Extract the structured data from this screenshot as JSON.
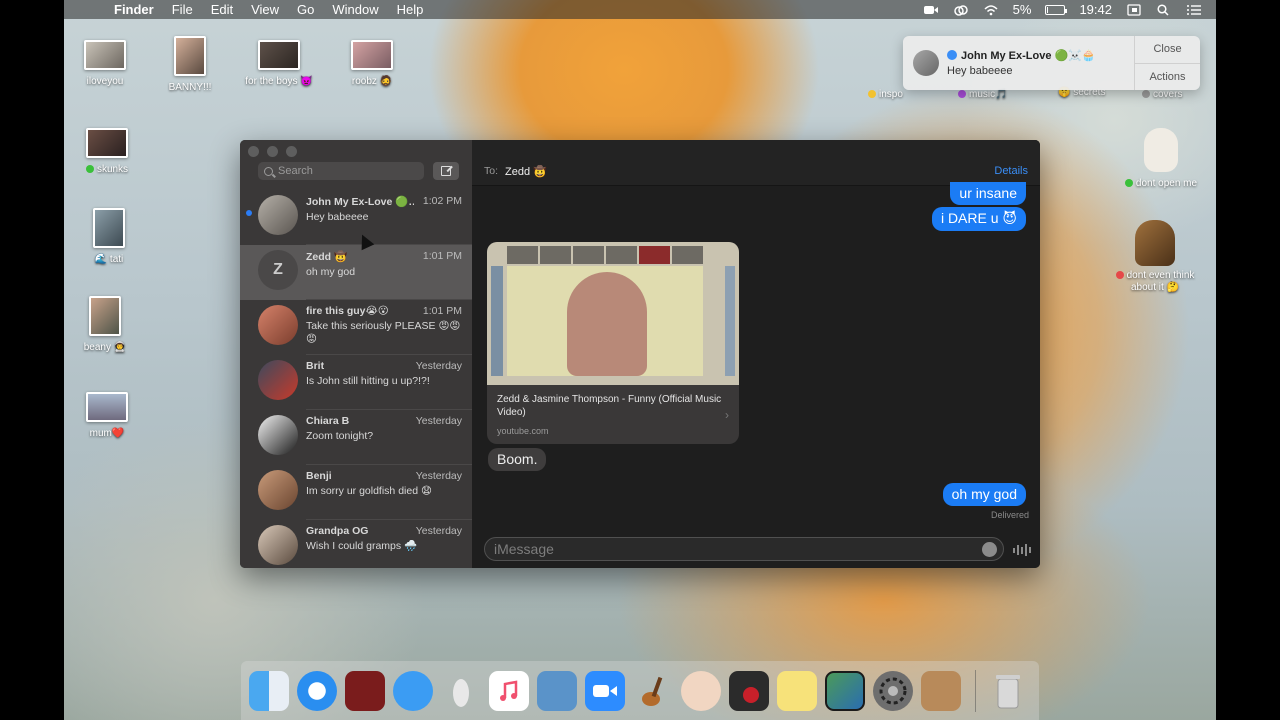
{
  "menubar": {
    "app_name": "Finder",
    "menus": [
      "File",
      "Edit",
      "View",
      "Go",
      "Window",
      "Help"
    ],
    "battery": "5%",
    "battery_level": 0.05,
    "clock": "19:42"
  },
  "desktop": {
    "icons": [
      {
        "label": "iloveyou"
      },
      {
        "label": "BANNY!!!"
      },
      {
        "label": "for the boys 👿"
      },
      {
        "label": "roobz 🧔"
      },
      {
        "label": "skunks"
      },
      {
        "label": "🌊 tati"
      },
      {
        "label": "beany 👨‍🚀"
      },
      {
        "label": "mum❤️"
      },
      {
        "label": "inspo"
      },
      {
        "label": "music🎵"
      },
      {
        "label": "🤫 secrets"
      },
      {
        "label": "covers"
      },
      {
        "label": "dont open me"
      },
      {
        "label": "dont even think about it 🤔"
      }
    ],
    "tag_colors": {
      "green": "#3ac03a",
      "yellow": "#f2c230",
      "purple": "#a64bd6",
      "red": "#e54848",
      "gray": "#9a9a9a"
    }
  },
  "notification": {
    "sender": "John My Ex-Love 🟢☠️🧁",
    "message": "Hey babeeee",
    "close_label": "Close",
    "actions_label": "Actions"
  },
  "messages": {
    "search_placeholder": "Search",
    "conversations": [
      {
        "name": "John My Ex-Love 🟢…",
        "time": "1:02 PM",
        "preview": "Hey babeeee",
        "unread": true
      },
      {
        "name": "Zedd 🤠",
        "time": "1:01 PM",
        "preview": "oh my god",
        "initial": "Z",
        "active": true
      },
      {
        "name": "fire this guy😭😮",
        "time": "1:01 PM",
        "preview": "Take this seriously PLEASE 😡😡😡"
      },
      {
        "name": "Brit",
        "time": "Yesterday",
        "preview": "Is John still hitting u up?!?!"
      },
      {
        "name": "Chiara B",
        "time": "Yesterday",
        "preview": "Zoom tonight?"
      },
      {
        "name": "Benji",
        "time": "Yesterday",
        "preview": "Im sorry ur goldfish died 😧"
      },
      {
        "name": "Grandpa OG",
        "time": "Yesterday",
        "preview": "Wish I could gramps 🌧️"
      }
    ],
    "chat": {
      "to_label": "To:",
      "recipient": "Zedd 🤠",
      "details_label": "Details",
      "bubbles": {
        "out1": "ur insane",
        "out2": "i DARE u 😈",
        "in1": "Boom.",
        "out3": "oh my god"
      },
      "link_card": {
        "title": "Zedd & Jasmine Thompson - Funny (Official Music Video)",
        "domain": "youtube.com"
      },
      "status": "Delivered",
      "input_placeholder": "iMessage"
    }
  },
  "dock": {
    "apps": [
      "finder",
      "safari",
      "photo-booth",
      "messages",
      "eggplant",
      "music",
      "seal",
      "zoom",
      "garageband",
      "face",
      "photo-app",
      "stickies",
      "preview",
      "system-preferences",
      "contacts",
      "trash"
    ]
  }
}
